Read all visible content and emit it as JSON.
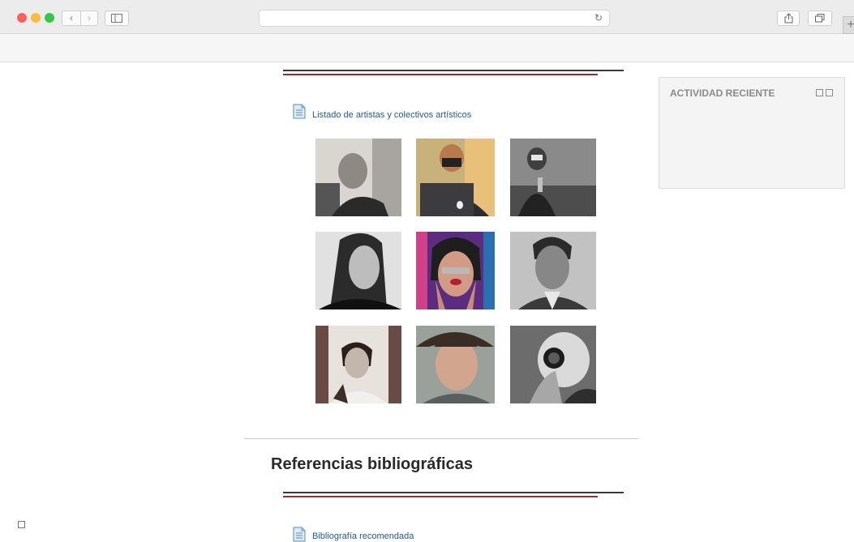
{
  "browser": {
    "back_glyph": "‹",
    "forward_glyph": "›",
    "reload_glyph": "↻",
    "new_tab_glyph": "+",
    "icons": [
      "sidebar-icon",
      "share-icon",
      "tabs-icon",
      "reload-icon"
    ]
  },
  "content": {
    "artists_link": "Listado de artistas y colectivos artísticos",
    "bibliography_heading": "Referencias bibliográficas",
    "bibliography_link": "Bibliografía recomendada"
  },
  "sidebar": {
    "block_title": "ACTIVIDAD RECIENTE"
  },
  "colors": {
    "link": "#245b8c",
    "accent_red": "#a3272b",
    "rule_dark": "#3a3a3a"
  }
}
